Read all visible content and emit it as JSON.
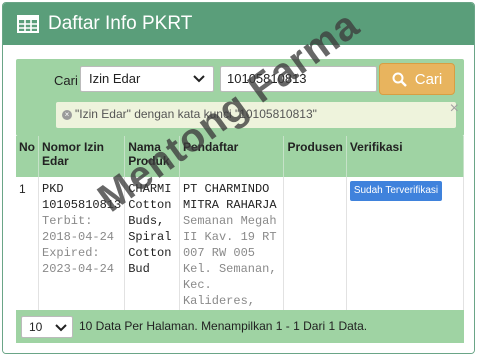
{
  "header": {
    "title": "Daftar Info PKRT",
    "icon": "table-icon"
  },
  "search": {
    "label": "Cari",
    "type_selected": "Izin Edar",
    "keyword_value": "10105810813",
    "button_label": "Cari",
    "filter_text": "\"Izin Edar\" dengan kata kunci \"10105810813\"",
    "filter_close": "×"
  },
  "table": {
    "headers": [
      "No",
      "Nomor Izin Edar",
      "Nama Produk",
      "Pendaftar",
      "Produsen",
      "Verifikasi"
    ],
    "rows": [
      {
        "no": "1",
        "nie": "PKD 10105810813",
        "terbit": "Terbit: 2018-04-24",
        "expired": "Expired: 2023-04-24",
        "produk": "CHARMI Cotton Buds, Spiral Cotton Bud",
        "pendaftar_name": "PT CHARMINDO MITRA RAHARJA",
        "pendaftar_addr": "Semanan Megah II Kav. 19 RT 007 RW 005 Kel. Semanan, Kec. Kalideres, Jakarta Barat",
        "produsen": "",
        "verifikasi": "Sudah Terverifikasi"
      }
    ]
  },
  "footer": {
    "per_page": "10",
    "info": "10 Data Per Halaman. Menampilkan 1 - 1 Dari 1 Data."
  },
  "watermark": "Mentong Farma",
  "colors": {
    "header": "#5a9e7a",
    "band": "#9fd3a3",
    "button": "#e8b45e",
    "badge": "#3f82dc"
  }
}
